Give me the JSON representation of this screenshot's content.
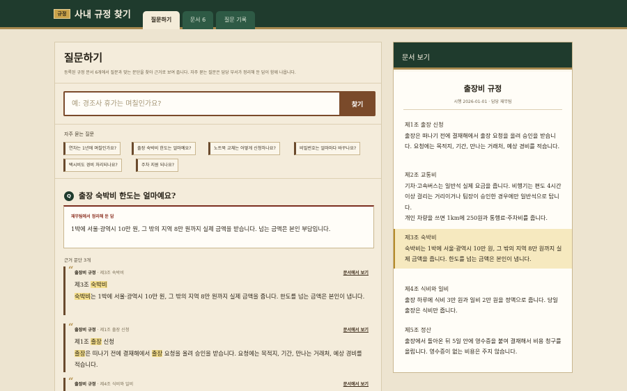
{
  "header": {
    "badge": "규정",
    "title": "사내 규정 찾기",
    "tabs": [
      {
        "label": "질문하기",
        "active": true
      },
      {
        "label": "문서 6",
        "active": false
      },
      {
        "label": "질문 기록",
        "active": false
      }
    ]
  },
  "ask": {
    "title": "질문하기",
    "description": "등록된 규정 문서 6개에서 질문과 맞는 문단을 찾아 근거로 보여 줍니다. 자주 묻는 질문은 담당 부서가 정리해 둔 답이 함께 나옵니다.",
    "search_placeholder": "예: 경조사 휴가는 며칠인가요?",
    "search_button": "찾기",
    "faq_label": "자주 묻는 질문",
    "faq_chips": [
      "연차는 1년에 며칠인가요?",
      "출장 숙박비 한도는 얼마예요?",
      "노트북 교체는 어떻게 신청하나요?",
      "비밀번호는 얼마마다 바꾸나요?",
      "택시비도 경비 처리되나요?",
      "주차 지원 되나요?"
    ]
  },
  "result": {
    "q_badge": "Q",
    "question": "출장 숙박비 한도는 얼마예요?",
    "answer_label": "재무팀에서 정리해 둔 답",
    "answer_text": "1박에 서울·광역시 10만 원, 그 밖의 지역 8만 원까지 실제 금액을 받습니다. 넘는 금액은 본인 부담입니다.",
    "basis_label": "근거 문단 3개",
    "evidence": [
      {
        "doc": "출장비 규정",
        "section": " · 제3조 숙박비",
        "link": "문서에서 보기",
        "title_pre": "제3조 ",
        "title_hl": "숙박비",
        "body_hl": "숙박비",
        "body_rest": "는 1박에 서울·광역시 10만 원, 그 밖의 지역 8만 원까지 실제 금액을 줍니다. 한도를 넘는 금액은 본인이 냅니다."
      },
      {
        "doc": "출장비 규정",
        "section": " · 제1조 출장 신청",
        "link": "문서에서 보기",
        "title_pre": "제1조 ",
        "title_hl": "출장",
        "title_post": " 신청",
        "body_hl": "출장",
        "body_mid": "은 떠나기 전에 결재해에서 ",
        "body_hl2": "출장",
        "body_rest": " 요청을 올려 승인을 받습니다. 요청에는 목적지, 기간, 만나는 거래처, 예상 경비를 적습니다."
      },
      {
        "doc": "출장비 규정",
        "section": " · 제4조 식비와 일비",
        "link": "문서에서 보기"
      }
    ]
  },
  "viewer": {
    "header": "문서 보기",
    "doc_title": "출장비 규정",
    "doc_meta": "시행 2026-01-01 · 담당 재무팀",
    "articles": [
      {
        "title": "제1조 출장 신청",
        "body": "출장은 떠나기 전에 결재해에서 출장 요청을 올려 승인을 받습니다. 요청에는 목적지, 기간, 만나는 거래처, 예상 경비를 적습니다."
      },
      {
        "title": "제2조 교통비",
        "body": "기차·고속버스는 일반석 실제 요금을 줍니다. 비행기는 편도 4시간 이상 걸리는 거리이거나 팀장이 승인한 경우에만 일반석으로 탑니다.",
        "body2": "개인 차량을 쓰면 1km에 250원과 통행료·주차비를 줍니다."
      },
      {
        "title": "제3조 숙박비",
        "body": "숙박비는 1박에 서울·광역시 10만 원, 그 밖의 지역 8만 원까지 실제 금액을 줍니다. 한도를 넘는 금액은 본인이 냅니다.",
        "active": true
      },
      {
        "title": "제4조 식비와 일비",
        "body": "출장 하루에 식비 3만 원과 일비 2만 원을 정액으로 줍니다. 당일 출장은 식비만 줍니다."
      },
      {
        "title": "제5조 정산",
        "body": "출장에서 돌아온 뒤 5일 안에 영수증을 붙여 결재해서 비용 청구를 올립니다. 영수증이 없는 비용은 주지 않습니다."
      }
    ]
  }
}
